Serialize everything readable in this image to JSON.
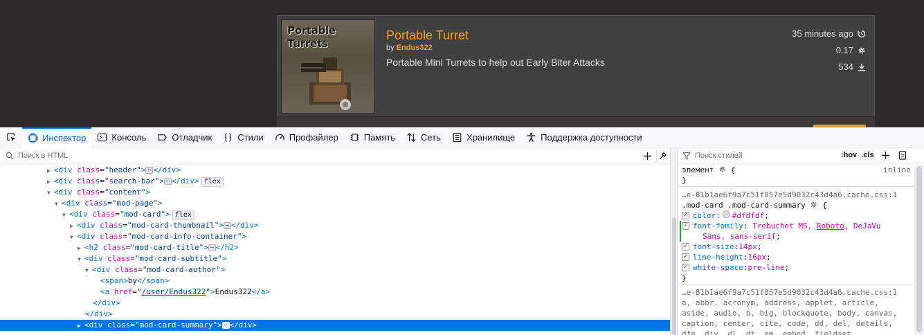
{
  "page": {
    "thumbnail_text": "Portable Turrets",
    "title": "Portable Turret",
    "by_label": "by",
    "author": "Endus322",
    "summary": "Portable Mini Turrets to help out Early Biter Attacks",
    "updated": "35 minutes ago",
    "version": "0.17",
    "downloads": "534"
  },
  "devtools": {
    "tabs": [
      {
        "label": "Инспектор",
        "icon": "inspector-icon"
      },
      {
        "label": "Консоль",
        "icon": "console-icon"
      },
      {
        "label": "Отладчик",
        "icon": "debugger-icon"
      },
      {
        "label": "Стили",
        "icon": "style-editor-icon"
      },
      {
        "label": "Профайлер",
        "icon": "profiler-icon"
      },
      {
        "label": "Память",
        "icon": "memory-icon"
      },
      {
        "label": "Сеть",
        "icon": "network-icon"
      },
      {
        "label": "Хранилище",
        "icon": "storage-icon"
      },
      {
        "label": "Поддержка доступности",
        "icon": "accessibility-icon"
      }
    ],
    "html_search_placeholder": "Поиск в HTML",
    "styles_search_placeholder": "Поиск стилей",
    "hov_label": ":hov",
    "cls_label": ".cls"
  },
  "tree": {
    "tag_div": "div",
    "tag_h2": "h2",
    "tag_span": "span",
    "tag_a": "a",
    "attr_class": "class",
    "attr_href": "href",
    "header": "\"header\"",
    "search_bar": "\"search-bar\"",
    "content": "\"content\"",
    "mod_page": "\"mod-page\"",
    "mod_card": "\"mod-card\"",
    "mod_card_thumbnail": "\"mod-card-thumbnail\"",
    "mod_card_info_container": "\"mod-card-info-container\"",
    "mod_card_title": "\"mod-card-title\"",
    "mod_card_subtitle": "\"mod-card-subtitle\"",
    "mod_card_author": "\"mod-card-author\"",
    "span_text": "by",
    "href_value": "/user/Endus322",
    "a_text": "Endus322",
    "mod_card_summary": "\"mod-card-summary\"",
    "flex_badge": "flex",
    "ellipsis": "⋯"
  },
  "rules": {
    "element_label": "элемент",
    "inline_label": "inline",
    "source": "…e-81b1ae6f9a7c51f857e5d9032c43d4a6.cache.css:1",
    "selector": ".mod-card .mod-card-summary",
    "declarations": [
      {
        "name": "color",
        "value": "#dfdfdf"
      },
      {
        "name": "font-family",
        "value": "Trebuchet MS, Roboto, DeJaVu Sans, sans-serif"
      },
      {
        "name": "font-size",
        "value": "14px"
      },
      {
        "name": "line-height",
        "value": "16px"
      },
      {
        "name": "white-space",
        "value": "pre-line"
      }
    ],
    "ff_part1": "Trebuchet MS, ",
    "ff_part2": "Roboto",
    "ff_part3": ", DeJaVu",
    "ff_part4": "Sans, sans-serif",
    "reset_source": "…e-81b1ae6f9a7c51f857e5d9032c43d4a6.cache.css:1",
    "reset_selectors": [
      "a, abbr, acronym, address, applet, article,",
      "aside, audio, b, big, blockquote, body, canvas,",
      "caption, center, cite, code, dd, del, details,",
      "dfn, div, dl, dt, em, embed, fieldset,"
    ],
    "colors": {
      "swatch": "#dfdfdf",
      "accent": "#0061e0",
      "selection": "#0074e8"
    }
  }
}
